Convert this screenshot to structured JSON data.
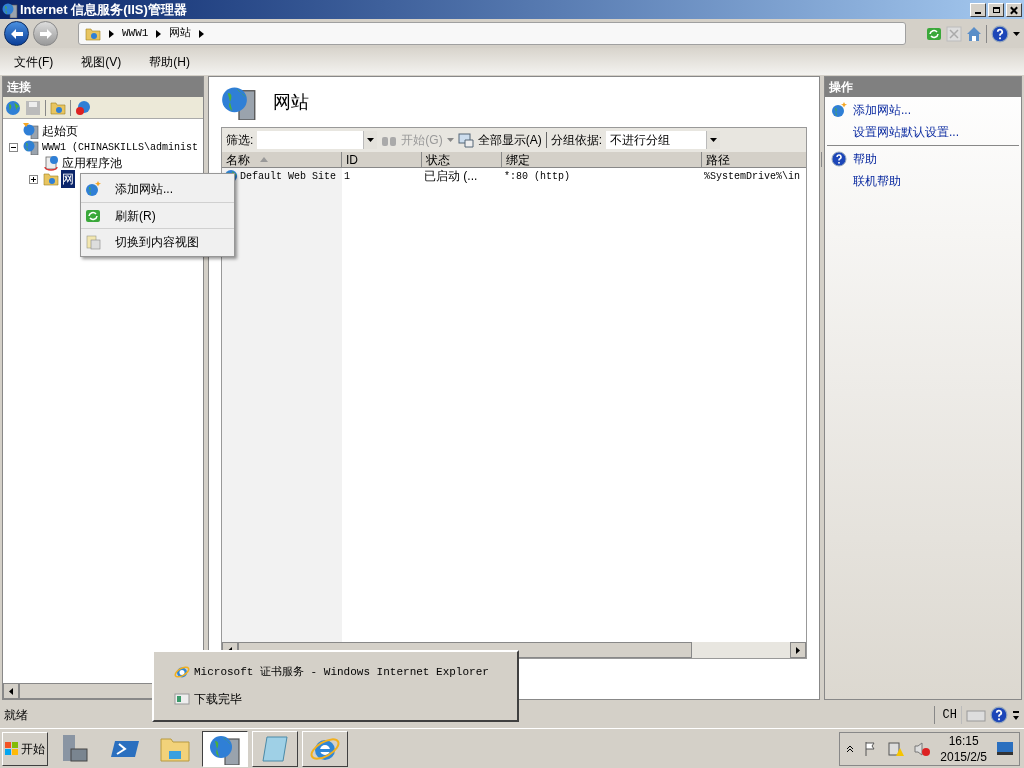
{
  "window": {
    "title": "Internet 信息服务(IIS)管理器"
  },
  "address": {
    "crumbs": [
      "WWW1",
      "网站"
    ]
  },
  "menu": [
    "文件(F)",
    "视图(V)",
    "帮助(H)"
  ],
  "connections": {
    "title": "连接",
    "tree": [
      {
        "label": "起始页",
        "kind": "start",
        "selected": false
      },
      {
        "label": "WWW1 (CHINASKILLS\\administ",
        "kind": "server",
        "selected": false,
        "expanded": true,
        "children": [
          {
            "label": "应用程序池",
            "kind": "pool",
            "selected": false
          },
          {
            "label": "网",
            "kind": "sites",
            "selected": true,
            "expanded": false
          }
        ]
      }
    ]
  },
  "context_menu": [
    {
      "label": "添加网站...",
      "kind": "add"
    },
    {
      "label": "刷新(R)",
      "kind": "refresh"
    },
    {
      "label": "切换到内容视图",
      "kind": "content"
    }
  ],
  "center": {
    "title": "网站",
    "filter_label": "筛选:",
    "start": "开始(G)",
    "show_all": "全部显示(A)",
    "group_label": "分组依据:",
    "group_value": "不进行分组",
    "columns": [
      "名称",
      "ID",
      "状态",
      "绑定",
      "路径"
    ],
    "rows": [
      [
        "Default Web Site",
        "1",
        "已启动 (...",
        "*:80 (http)",
        "%SystemDrive%\\in"
      ]
    ]
  },
  "actions": {
    "title": "操作",
    "groups": [
      [
        {
          "label": "添加网站...",
          "kind": "add"
        },
        {
          "label": "设置网站默认设置...",
          "kind": "none"
        }
      ],
      [
        {
          "label": "帮助",
          "kind": "help"
        },
        {
          "label": "联机帮助",
          "kind": "none"
        }
      ]
    ]
  },
  "status": {
    "text": "就绪",
    "ime": "CH"
  },
  "taskbar": {
    "start": "开始",
    "apps": [
      {
        "kind": "server",
        "selected": false
      },
      {
        "kind": "shell",
        "selected": false
      },
      {
        "kind": "folder",
        "selected": false
      },
      {
        "kind": "iis",
        "selected": true
      },
      {
        "kind": "notepad",
        "selected": false
      },
      {
        "kind": "ie",
        "selected": false
      }
    ],
    "time": "16:15",
    "date": "2015/2/5"
  },
  "popup": [
    {
      "label": "Microsoft 证书服务 - Windows Internet Explorer",
      "kind": "ie"
    },
    {
      "label": "下载完毕",
      "kind": "download"
    }
  ]
}
